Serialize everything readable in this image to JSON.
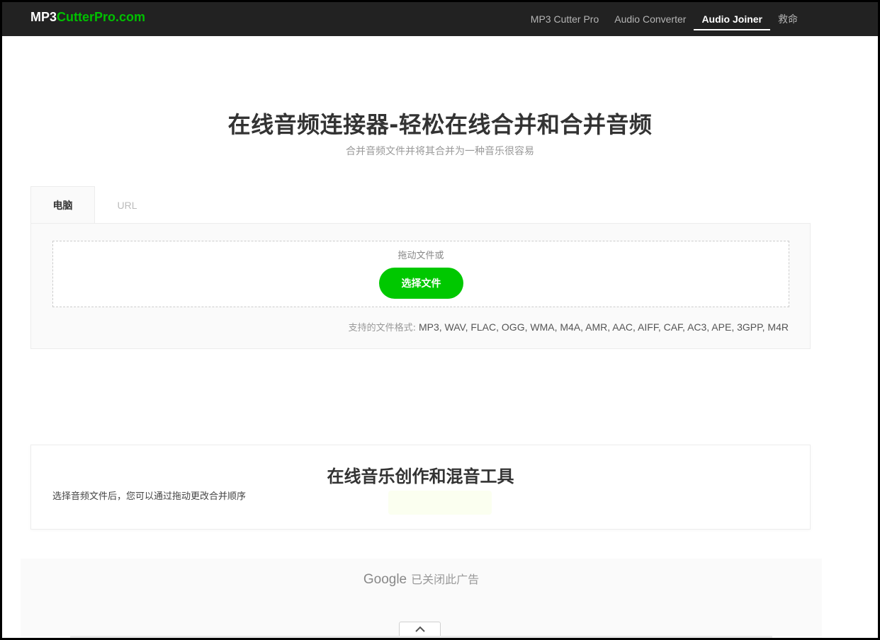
{
  "header": {
    "logo_part1": "MP3",
    "logo_part2": "CutterPro.com",
    "nav": [
      {
        "label": "MP3 Cutter Pro"
      },
      {
        "label": "Audio Converter"
      },
      {
        "label": "Audio Joiner"
      },
      {
        "label": "救命"
      }
    ],
    "active_nav": "Audio Joiner"
  },
  "hero": {
    "title": "在线音频连接器-轻松在线合并和合并音频",
    "subtitle": "合并音频文件并将其合并为一种音乐很容易"
  },
  "upload": {
    "tabs": [
      {
        "label": "电脑"
      },
      {
        "label": "URL"
      }
    ],
    "active_tab": "电脑",
    "drop_label": "拖动文件或",
    "choose_button": "选择文件",
    "formats_label": "支持的文件格式:",
    "formats": "MP3, WAV, FLAC, OGG, WMA, M4A, AMR, AAC, AIFF, CAF, AC3, APE, 3GPP, M4R"
  },
  "tools": {
    "title": "在线音乐创作和混音工具",
    "note": "选择音频文件后，您可以通过拖动更改合并顺序"
  },
  "ad": {
    "brand": "Google",
    "text": "已关闭此广告"
  },
  "colors": {
    "accent": "#00c800",
    "header_bg": "#222222"
  }
}
